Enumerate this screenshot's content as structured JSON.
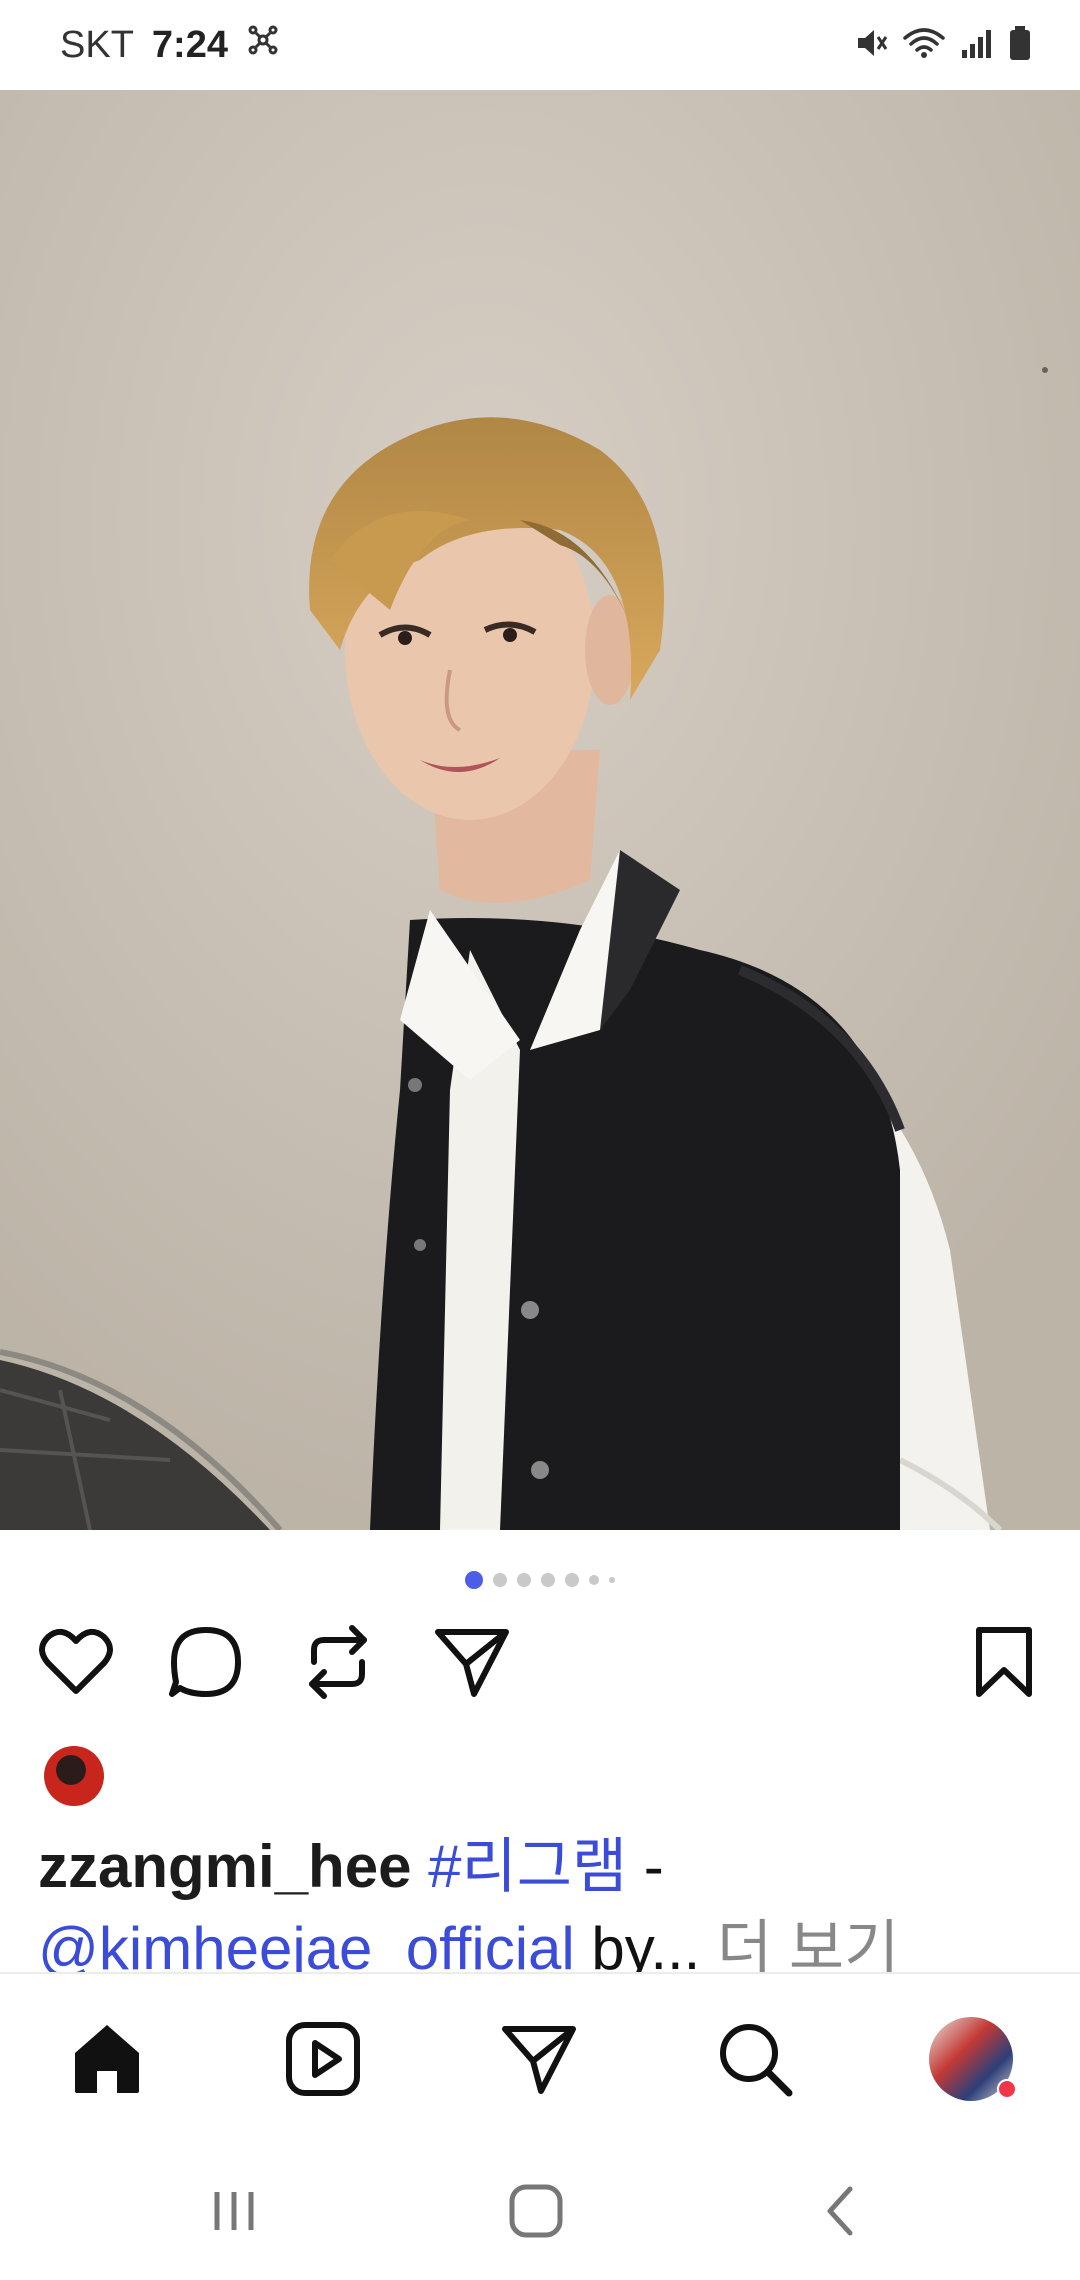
{
  "status_bar": {
    "carrier": "SKT",
    "time": "7:24"
  },
  "post": {
    "carousel": {
      "total": 7,
      "active_index": 0
    },
    "caption": {
      "username": "zzangmi_hee",
      "hashtag": "#리그램",
      "separator": "-",
      "mention": "@kimheejae_official",
      "trailing": "by...",
      "more_label": "더 보기"
    }
  },
  "icons": {
    "like": "heart-icon",
    "comment": "comment-icon",
    "repost": "repost-icon",
    "share": "send-icon",
    "save": "bookmark-icon"
  },
  "colors": {
    "accent": "#3b4cd8",
    "active_dot": "#4c5de8",
    "notification": "#f0374a"
  }
}
